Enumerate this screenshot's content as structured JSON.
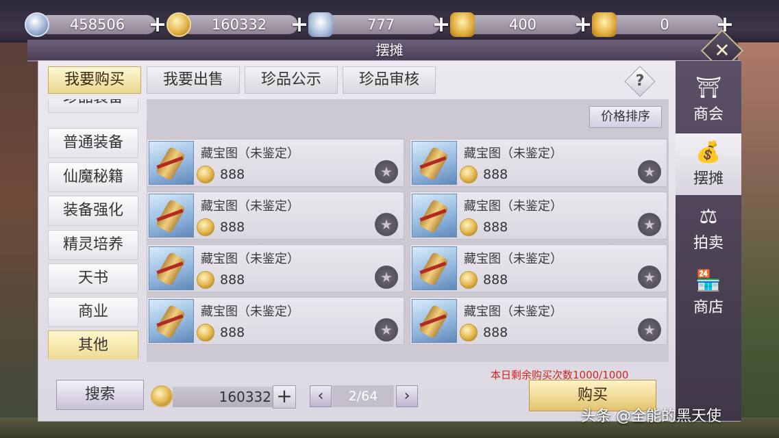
{
  "currencies": [
    {
      "value": "458506",
      "icon": "silver-coin-icon"
    },
    {
      "value": "160332",
      "icon": "gold-coin-icon"
    },
    {
      "value": "777",
      "icon": "silver-ingot-icon"
    },
    {
      "value": "400",
      "icon": "gold-ingot-icon"
    },
    {
      "value": "0",
      "icon": "gold-ingot-icon"
    }
  ],
  "window": {
    "title": "摆摊"
  },
  "tabs": [
    "我要购买",
    "我要出售",
    "珍品公示",
    "珍品审核"
  ],
  "categories": [
    "珍品装备",
    "普通装备",
    "仙魔秘籍",
    "装备强化",
    "精灵培养",
    "天书",
    "商业",
    "其他"
  ],
  "sort_label": "价格排序",
  "items": [
    {
      "name": "藏宝图（未鉴定）",
      "price": "888"
    },
    {
      "name": "藏宝图（未鉴定）",
      "price": "888"
    },
    {
      "name": "藏宝图（未鉴定）",
      "price": "888"
    },
    {
      "name": "藏宝图（未鉴定）",
      "price": "888"
    },
    {
      "name": "藏宝图（未鉴定）",
      "price": "888"
    },
    {
      "name": "藏宝图（未鉴定）",
      "price": "888"
    },
    {
      "name": "藏宝图（未鉴定）",
      "price": "888"
    },
    {
      "name": "藏宝图（未鉴定）",
      "price": "888"
    }
  ],
  "remaining_text": "本日剩余购买次数1000/1000",
  "search_label": "搜索",
  "money": "160332",
  "page": "2/64",
  "buy_label": "购买",
  "side_nav": [
    "商会",
    "摆摊",
    "拍卖",
    "商店"
  ],
  "watermark": "头条 @全能的黑天使",
  "colors": {
    "accent_gold": "#e9d68a",
    "panel_purple": "#4b4058",
    "warning_red": "#d2241e"
  }
}
